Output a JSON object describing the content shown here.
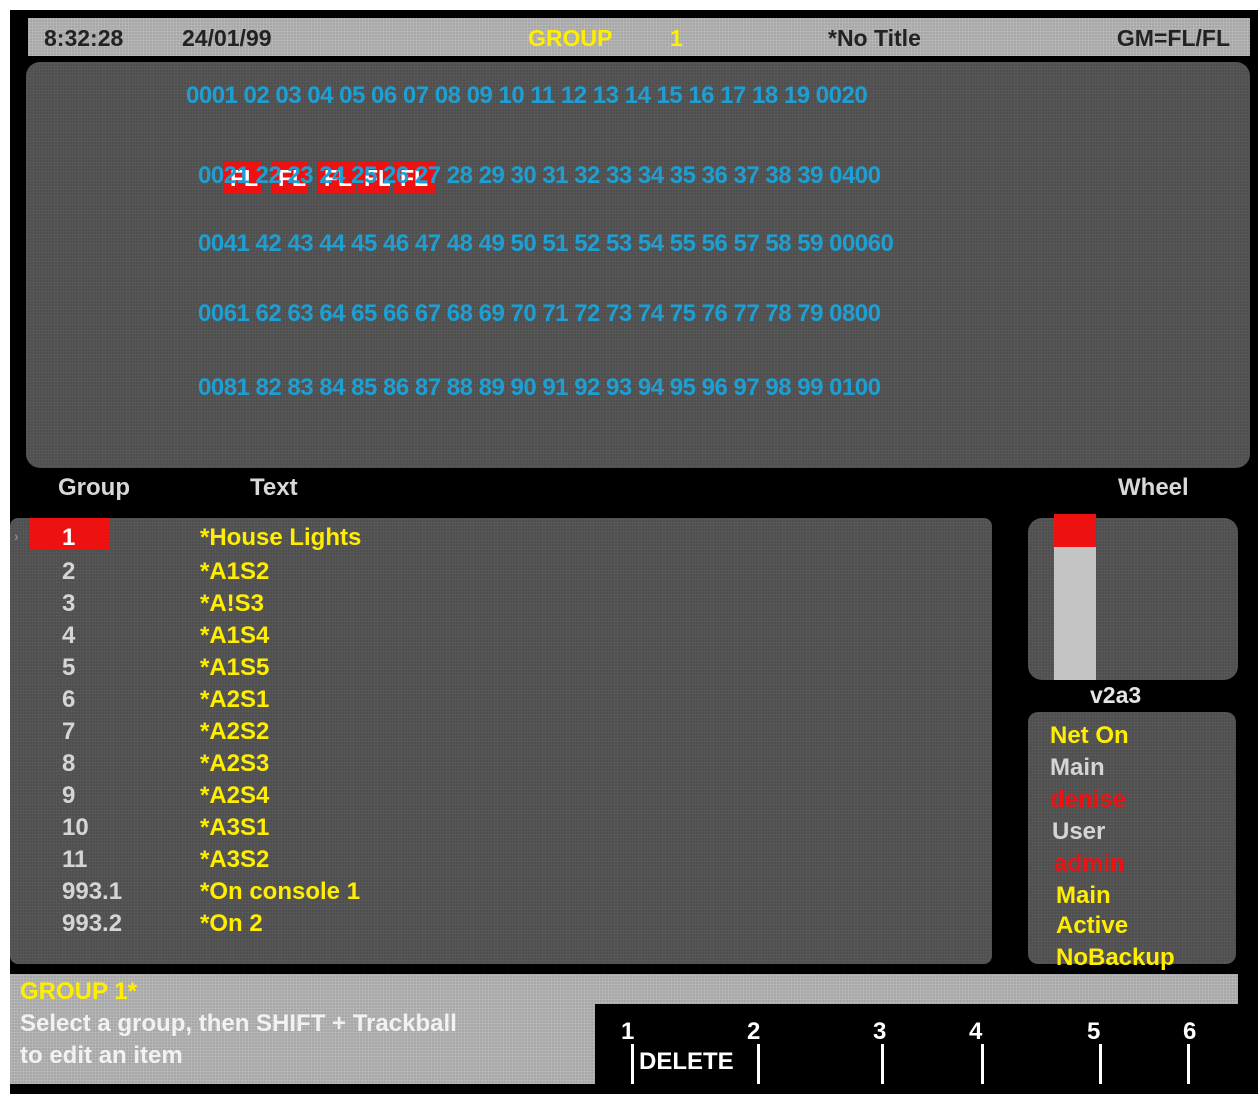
{
  "titlebar": {
    "time": "8:32:28",
    "date": "24/01/99",
    "mode": "GROUP",
    "group_number": "1",
    "show_title": "*No Title",
    "grandmaster": "GM=FL/FL"
  },
  "channels": {
    "rows": [
      "0001 02 03 04 05 06 07 08 09 10 11 12 13 14 15 16 17 18 19 0020",
      "0021 22 23 24 25 26 27 28 29 30 31 32 33 34 35 36 37 38 39 0400",
      "0041 42 43 44 45 46 47 48 49 50 51 52 53 54 55 56 57 58 59 00060",
      "0061 62 63 64 65 66 67 68 69 70 71 72 73 74 75 76 77 78 79 0800",
      "0081 82 83 84 85 86 87 88 89 90 91 92 93 94 95 96 97 98 99 0100"
    ],
    "levels": [
      "FL",
      "FL",
      "FL",
      "FL",
      "FL"
    ]
  },
  "headers": {
    "group": "Group",
    "text": "Text",
    "wheel": "Wheel"
  },
  "groups": [
    {
      "number": "1",
      "text": "*House Lights"
    },
    {
      "number": "2",
      "text": "*A1S2"
    },
    {
      "number": "3",
      "text": "*A!S3"
    },
    {
      "number": "4",
      "text": "*A1S4"
    },
    {
      "number": "5",
      "text": "*A1S5"
    },
    {
      "number": "6",
      "text": "*A2S1"
    },
    {
      "number": "7",
      "text": "*A2S2"
    },
    {
      "number": "8",
      "text": "*A2S3"
    },
    {
      "number": "9",
      "text": "*A2S4"
    },
    {
      "number": "10",
      "text": "*A3S1"
    },
    {
      "number": "11",
      "text": "*A3S2"
    },
    {
      "number": "993.1",
      "text": "*On console 1"
    },
    {
      "number": "993.2",
      "text": "*On 2"
    }
  ],
  "selected_group_index": 0,
  "cursor_glyph": "›",
  "wheel": {
    "level_fraction": 0.2,
    "version": "v2a3"
  },
  "status": {
    "net": "Net On",
    "main1": "Main",
    "user_name": "denise",
    "user_label": "User",
    "role": "admin",
    "main2": "Main",
    "state": "Active",
    "backup": "NoBackup"
  },
  "colors": {
    "yellow": "#ffee00",
    "red": "#ee1111",
    "cyan": "#1e9fd4",
    "light_text": "#d5d5d5"
  },
  "command": {
    "line": "GROUP 1*",
    "prompt_line1": "Select a group, then SHIFT + Trackball",
    "prompt_line2": "to edit an item"
  },
  "softkeys": [
    {
      "number": "1",
      "label": "DELETE"
    },
    {
      "number": "2",
      "label": ""
    },
    {
      "number": "3",
      "label": ""
    },
    {
      "number": "4",
      "label": ""
    },
    {
      "number": "5",
      "label": ""
    },
    {
      "number": "6",
      "label": ""
    }
  ]
}
